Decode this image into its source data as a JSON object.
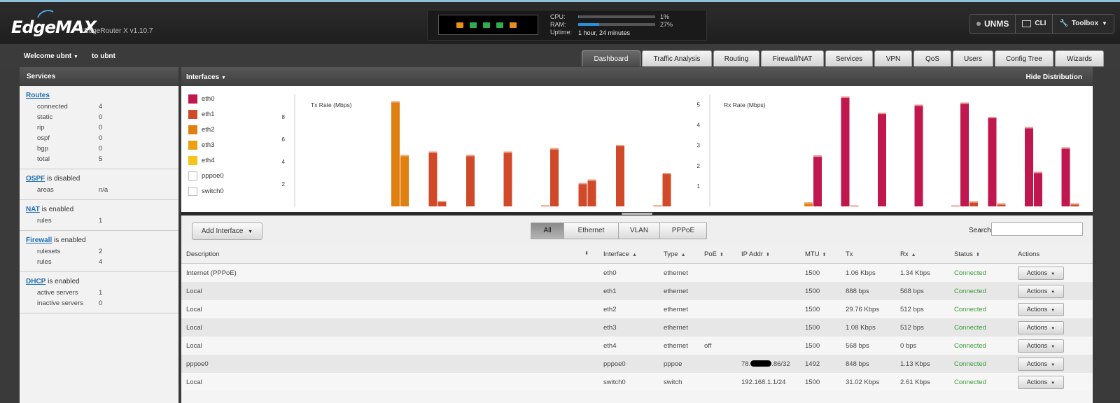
{
  "header": {
    "brand": "EdgeMAX",
    "model": "EdgeRouter X v1.10.7",
    "cpu_label": "CPU:",
    "cpu_value": "1%",
    "cpu_fraction": 0.01,
    "ram_label": "RAM:",
    "ram_value": "27%",
    "ram_fraction": 0.27,
    "uptime_label": "Uptime:",
    "uptime_value": "1 hour, 24 minutes",
    "port_colors": [
      "#e8901a",
      "#2eae4f",
      "#2eae4f",
      "#2eae4f",
      "#e8901a"
    ],
    "buttons": {
      "unms": "UNMS",
      "cli": "CLI",
      "toolbox": "Toolbox"
    }
  },
  "user": {
    "welcome": "Welcome ubnt",
    "to": "to ubnt"
  },
  "tabs": [
    "Dashboard",
    "Traffic Analysis",
    "Routing",
    "Firewall/NAT",
    "Services",
    "VPN",
    "QoS",
    "Users",
    "Config Tree",
    "Wizards"
  ],
  "sidebar": {
    "title": "Services",
    "routes": {
      "link": "Routes",
      "rows": [
        {
          "k": "connected",
          "v": "4"
        },
        {
          "k": "static",
          "v": "0"
        },
        {
          "k": "rip",
          "v": "0"
        },
        {
          "k": "ospf",
          "v": "0"
        },
        {
          "k": "bgp",
          "v": "0"
        },
        {
          "k": "total",
          "v": "5"
        }
      ]
    },
    "ospf": {
      "link": "OSPF",
      "state": " is disabled",
      "rows": [
        {
          "k": "areas",
          "v": "n/a"
        }
      ]
    },
    "nat": {
      "link": "NAT",
      "state": " is enabled",
      "rows": [
        {
          "k": "rules",
          "v": "1"
        }
      ]
    },
    "firewall": {
      "link": "Firewall",
      "state": " is enabled",
      "rows": [
        {
          "k": "rulesets",
          "v": "2"
        },
        {
          "k": "rules",
          "v": "4"
        }
      ]
    },
    "dhcp": {
      "link": "DHCP",
      "state": " is enabled",
      "rows": [
        {
          "k": "active servers",
          "v": "1"
        },
        {
          "k": "inactive servers",
          "v": "0"
        }
      ]
    }
  },
  "interfaces": {
    "title": "Interfaces",
    "hide_dist": "Hide Distribution",
    "legend": [
      {
        "name": "eth0",
        "color": "#c0174f"
      },
      {
        "name": "eth1",
        "color": "#d04a2a"
      },
      {
        "name": "eth2",
        "color": "#e08010"
      },
      {
        "name": "eth3",
        "color": "#eda010"
      },
      {
        "name": "eth4",
        "color": "#f5c518"
      },
      {
        "name": "pppoe0",
        "color": "#ffffff"
      },
      {
        "name": "switch0",
        "color": "#ffffff"
      }
    ]
  },
  "chart_data": [
    {
      "type": "bar",
      "title": "Tx Rate (Mbps)",
      "ylim": [
        0,
        10
      ],
      "yticks": [
        "2",
        "4",
        "6",
        "8"
      ],
      "groups": [
        [
          {
            "s": "eth2",
            "v": 9.4
          },
          {
            "s": "eth2",
            "v": 4.6
          }
        ],
        [
          {
            "s": "eth1",
            "v": 4.9
          },
          {
            "s": "eth1",
            "v": 0.5
          }
        ],
        [
          {
            "s": "eth1",
            "v": 4.6
          }
        ],
        [
          {
            "s": "eth1",
            "v": 4.9
          }
        ],
        [
          {
            "s": "eth1",
            "v": 0.1
          },
          {
            "s": "eth1",
            "v": 5.2
          }
        ],
        [
          {
            "s": "eth1",
            "v": 2.1
          },
          {
            "s": "eth1",
            "v": 2.4
          }
        ],
        [
          {
            "s": "eth1",
            "v": 5.5
          }
        ],
        [
          {
            "s": "eth1",
            "v": 0.1
          },
          {
            "s": "eth1",
            "v": 3.0
          }
        ]
      ]
    },
    {
      "type": "bar",
      "title": "Rx Rate (Mbps)",
      "ylim": [
        0,
        5.5
      ],
      "yticks": [
        "1",
        "2",
        "3",
        "4",
        "5"
      ],
      "groups": [
        [
          {
            "s": "eth2",
            "v": 0.2
          },
          {
            "s": "eth0",
            "v": 2.5
          }
        ],
        [
          {
            "s": "eth0",
            "v": 5.4
          },
          {
            "s": "eth0",
            "v": 0.05
          }
        ],
        [
          {
            "s": "eth0",
            "v": 4.6
          }
        ],
        [
          {
            "s": "eth0",
            "v": 5.0
          }
        ],
        [
          {
            "s": "eth0",
            "v": 0.05
          },
          {
            "s": "eth0",
            "v": 5.1
          },
          {
            "s": "eth1",
            "v": 0.25
          }
        ],
        [
          {
            "s": "eth0",
            "v": 4.4
          },
          {
            "s": "eth1",
            "v": 0.15
          }
        ],
        [
          {
            "s": "eth0",
            "v": 3.9
          },
          {
            "s": "eth0",
            "v": 1.7
          }
        ],
        [
          {
            "s": "eth0",
            "v": 2.9
          },
          {
            "s": "eth1",
            "v": 0.15
          }
        ]
      ]
    }
  ],
  "toolbar": {
    "add_interface": "Add Interface",
    "filters": [
      "All",
      "Ethernet",
      "VLAN",
      "PPPoE"
    ],
    "active_filter": "All",
    "search_label": "Search",
    "search_value": ""
  },
  "table": {
    "columns": [
      "Description",
      "Interface",
      "Type",
      "PoE",
      "IP Addr",
      "MTU",
      "Tx",
      "Rx",
      "Status",
      "Actions"
    ],
    "rows": [
      {
        "desc": "Internet (PPPoE)",
        "iface": "eth0",
        "type": "ethernet",
        "poe": "",
        "ip": "",
        "mtu": "1500",
        "tx": "1.06 Kbps",
        "rx": "1.34 Kbps",
        "status": "Connected",
        "action": "Actions"
      },
      {
        "desc": "Local",
        "iface": "eth1",
        "type": "ethernet",
        "poe": "",
        "ip": "",
        "mtu": "1500",
        "tx": "888 bps",
        "rx": "568 bps",
        "status": "Connected",
        "action": "Actions"
      },
      {
        "desc": "Local",
        "iface": "eth2",
        "type": "ethernet",
        "poe": "",
        "ip": "",
        "mtu": "1500",
        "tx": "29.76 Kbps",
        "rx": "512 bps",
        "status": "Connected",
        "action": "Actions"
      },
      {
        "desc": "Local",
        "iface": "eth3",
        "type": "ethernet",
        "poe": "",
        "ip": "",
        "mtu": "1500",
        "tx": "1.08 Kbps",
        "rx": "512 bps",
        "status": "Connected",
        "action": "Actions"
      },
      {
        "desc": "Local",
        "iface": "eth4",
        "type": "ethernet",
        "poe": "off",
        "ip": "",
        "mtu": "1500",
        "tx": "568 bps",
        "rx": "0 bps",
        "status": "Connected",
        "action": "Actions"
      },
      {
        "desc": "pppoe0",
        "iface": "pppoe0",
        "type": "pppoe",
        "poe": "",
        "ip": "78.",
        "ip_suffix": ".86/32",
        "mtu": "1492",
        "tx": "848 bps",
        "rx": "1.13 Kbps",
        "status": "Connected",
        "action": "Actions"
      },
      {
        "desc": "Local",
        "iface": "switch0",
        "type": "switch",
        "poe": "",
        "ip": "192.168.1.1/24",
        "mtu": "1500",
        "tx": "31.02 Kbps",
        "rx": "2.61 Kbps",
        "status": "Connected",
        "action": "Actions"
      }
    ]
  }
}
